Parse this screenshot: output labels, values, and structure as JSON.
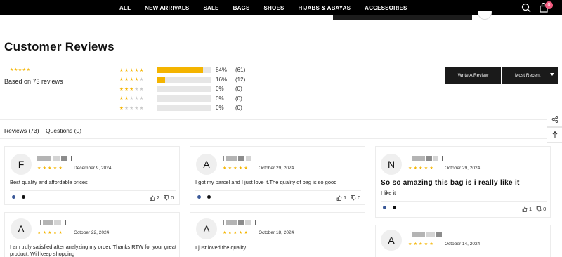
{
  "nav": {
    "items": [
      "ALL",
      "NEW ARRIVALS",
      "SALE",
      "BAGS",
      "SHOES",
      "HIJABS & ABAYAS",
      "ACCESSORIES"
    ],
    "cart_count": "0",
    "icons": [
      "search-icon",
      "cart-icon"
    ]
  },
  "reviews_section": {
    "title": "Customer Reviews",
    "based_on": "Based on 73 reviews",
    "summary_stars": "★★★★★",
    "distribution": [
      {
        "stars": 5,
        "percent": "84%",
        "count": "(61)",
        "fill": 0.84
      },
      {
        "stars": 4,
        "percent": "16%",
        "count": "(12)",
        "fill": 0.16
      },
      {
        "stars": 3,
        "percent": "0%",
        "count": "(0)",
        "fill": 0
      },
      {
        "stars": 2,
        "percent": "0%",
        "count": "(0)",
        "fill": 0
      },
      {
        "stars": 1,
        "percent": "0%",
        "count": "(0)",
        "fill": 0
      }
    ],
    "write_review_label": "Write A Review",
    "sort_label": "Most Recent"
  },
  "tabs": {
    "reviews": "Reviews (73)",
    "questions": "Questions (0)"
  },
  "reviews": [
    {
      "initial": "F",
      "stars": "★★★★★",
      "date": "December 9, 2024",
      "text": "Best quality and affordable prices",
      "up": "2",
      "down": "0"
    },
    {
      "initial": "A",
      "stars": "★★★★★",
      "date": "October 29, 2024",
      "text": "I got my parcel and I just love it.The quality of bag is so good .",
      "up": "1",
      "down": "0"
    },
    {
      "initial": "N",
      "stars": "★★★★★",
      "date": "October 29, 2024",
      "text_title": "So so amazing this bag is i really like it",
      "text": "I like it",
      "up": "1",
      "down": "0"
    },
    {
      "initial": "A",
      "stars": "★★★★★",
      "date": "October 22, 2024",
      "text": "I am truly satisfied after analyzing my order. Thanks RTW for your great product. Will keep shopping"
    },
    {
      "initial": "A",
      "stars": "★★★★★",
      "date": "October 18, 2024",
      "text": "I just loved the quality"
    },
    {
      "initial": "A",
      "stars": "★★★★★",
      "date": "October 14, 2024"
    }
  ],
  "colors": {
    "nav_bg": "#000000",
    "star": "#f4b400",
    "button_bg": "#1a1a1a",
    "cart_badge": "#f05a7e"
  }
}
